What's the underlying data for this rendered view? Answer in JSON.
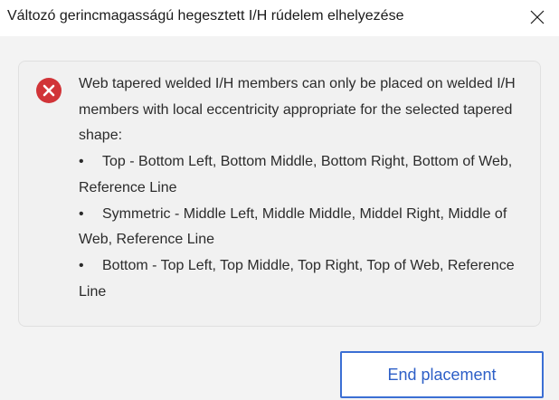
{
  "window": {
    "title": "Változó gerincmagasságú hegesztett I/H rúdelem elhelyezése",
    "close_icon": "close-icon"
  },
  "message": {
    "icon": "error-icon",
    "icon_color": "#d13438",
    "intro": "Web tapered welded I/H members can only be placed on welded I/H members with local eccentricity appropriate for the selected tapered shape:",
    "bullet_glyph": "•",
    "items": [
      "Top - Bottom Left, Bottom Middle, Bottom Right, Bottom of Web, Reference Line",
      "Symmetric - Middle Left, Middle Middle, Middel Right, Middle of Web, Reference Line",
      "Bottom - Top Left, Top Middle, Top Right, Top of Web, Reference Line"
    ]
  },
  "actions": {
    "end_placement_label": "End placement",
    "accent_color": "#3b6fd4"
  }
}
